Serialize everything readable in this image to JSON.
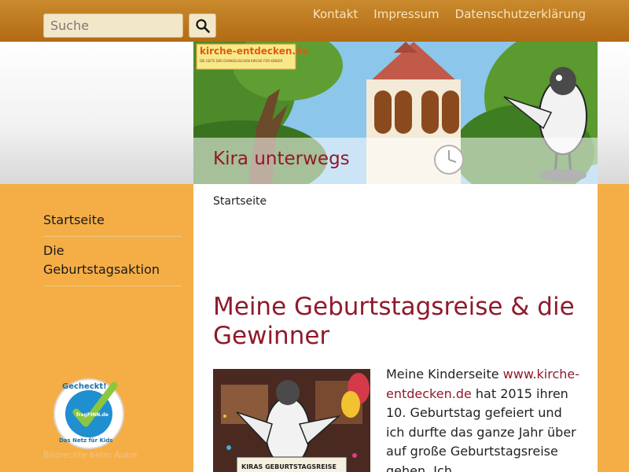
{
  "search": {
    "placeholder": "Suche",
    "icon": "search-icon"
  },
  "nav": {
    "items": [
      "Kontakt",
      "Impressum",
      "Datenschutzerklärung"
    ]
  },
  "banner": {
    "logo_text": "kirche-entdecken.de",
    "logo_tagline": "DIE SEITE DER EVANGELISCHEN KIRCHE FÜR KINDER",
    "caption": "Kira unterwegs"
  },
  "sidebar": {
    "items": [
      "Startseite",
      "Die Geburtstagsaktion"
    ]
  },
  "badge": {
    "line1": "Gecheckt!",
    "line2": "Das Netz für Kids",
    "brand": "fragFINN.de"
  },
  "credit": "Bildrechte beim Autor",
  "breadcrumb": "Startseite",
  "article": {
    "title": "Meine Geburtstagsreise & die Gewinner",
    "text_before": "Meine Kinderseite ",
    "link": "www.kirche-entdecken.de",
    "text_after": " hat 2015 ihren 10. Geburtstag gefeiert und ich durfte das ganze Jahr über auf große Geburtstagsreise gehen. Ich",
    "image_sign": "KIRAS GEBURTSTAGSREISE"
  },
  "colors": {
    "accent": "#8f1a2b",
    "sidebar": "#f5ae46",
    "topbar": "#b36a16"
  }
}
